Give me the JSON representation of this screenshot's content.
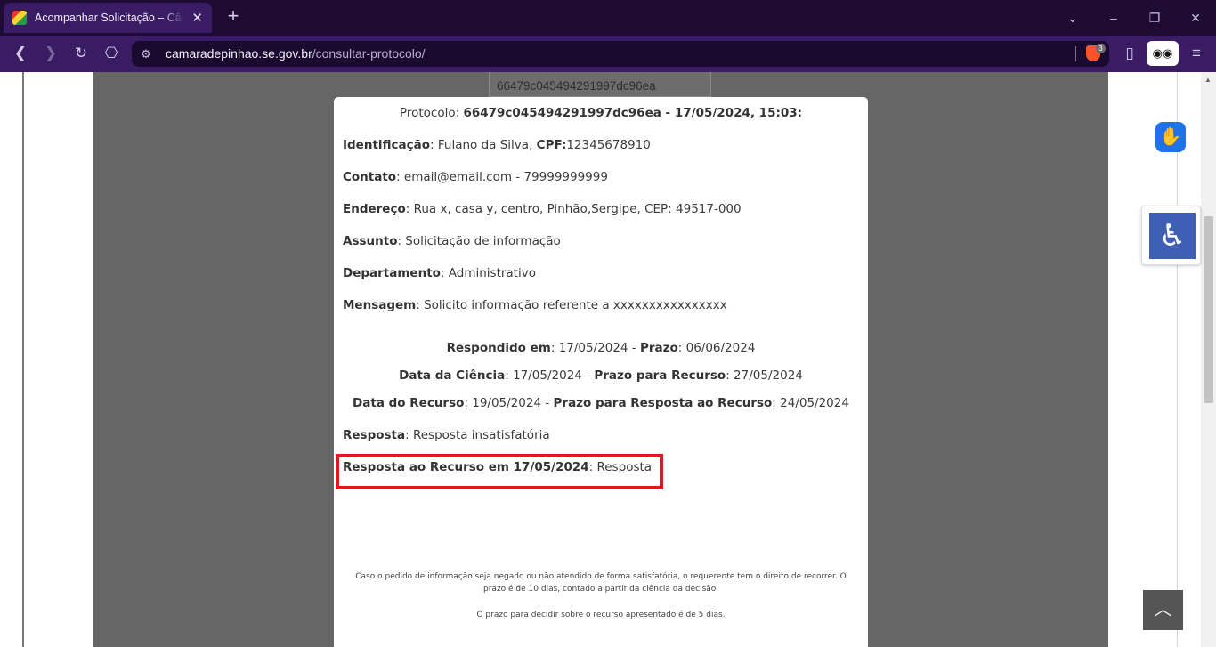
{
  "browser": {
    "tab_title": "Acompanhar Solicitação – Câmara",
    "tab_close": "✕",
    "new_tab": "+",
    "url_host": "camaradepinhao.se.gov.br",
    "url_path": "/consultar-protocolo/",
    "shields_badge": "3"
  },
  "background": {
    "protocol_field_value": "66479c045494291997dc96ea"
  },
  "modal": {
    "protocolo_label": "Protocolo: ",
    "protocolo_value": "66479c045494291997dc96ea - 17/05/2024, 15:03:",
    "identificacao_label": "Identificação",
    "identificacao_value": ": Fulano da Silva, ",
    "cpf_label": "CPF:",
    "cpf_value": "12345678910",
    "contato_label": "Contato",
    "contato_value": ": email@email.com - 79999999999",
    "endereco_label": "Endereço",
    "endereco_value": ": Rua x, casa y, centro, Pinhão,Sergipe, CEP: 49517-000",
    "assunto_label": "Assunto",
    "assunto_value": ": Solicitação de informação",
    "departamento_label": "Departamento",
    "departamento_value": ": Administrativo",
    "mensagem_label": "Mensagem",
    "mensagem_value": ": Solicito informação referente a xxxxxxxxxxxxxxxx",
    "respondido_label": "Respondido em",
    "respondido_value": ": 17/05/2024 - ",
    "prazo_label": "Prazo",
    "prazo_value": ": 06/06/2024",
    "ciencia_label": "Data da Ciência",
    "ciencia_value": ":  17/05/2024 - ",
    "prazo_recurso_label": "Prazo para Recurso",
    "prazo_recurso_value": ": 27/05/2024",
    "data_recurso_label": "Data do Recurso",
    "data_recurso_value": ": 19/05/2024 - ",
    "prazo_resposta_recurso_label": "Prazo para Resposta ao Recurso",
    "prazo_resposta_recurso_value": ": 24/05/2024",
    "resposta_label": "Resposta",
    "resposta_value": ": Resposta insatisfatória",
    "resposta_recurso_label": "Resposta ao Recurso em 17/05/2024",
    "resposta_recurso_value": ": Resposta",
    "note_1": "Caso o pedido de informação seja negado ou não atendido de forma satisfatória, o requerente tem o direito de recorrer. O prazo é de 10 dias, contado a partir da ciência da decisão.",
    "note_2": "O prazo para decidir sobre o recurso apresentado é de 5 dias."
  },
  "colors": {
    "browser_title_bg": "#1e0b33",
    "browser_toolbar_bg": "#3a1c64",
    "overlay_gray": "#666666",
    "highlight_red": "#e0191f",
    "accessibility_blue": "#3f5fb5"
  },
  "icons": [
    "favicon",
    "close-icon",
    "plus-icon",
    "chevron-down-icon",
    "minimize-icon",
    "restore-icon",
    "back-icon",
    "forward-icon",
    "reload-icon",
    "bookmark-icon",
    "site-settings-icon",
    "brave-shields-icon",
    "sidebar-icon",
    "glasses-icon",
    "menu-icon",
    "sign-language-icon",
    "wheelchair-icon",
    "arrow-up-icon"
  ]
}
